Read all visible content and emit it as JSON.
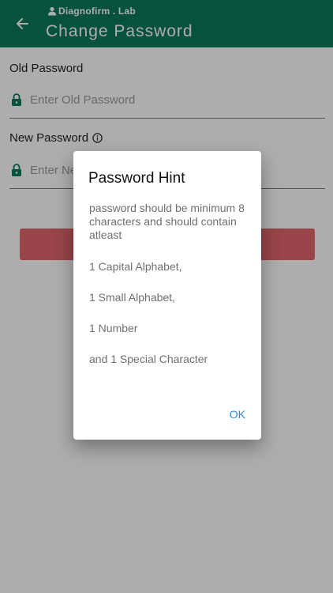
{
  "header": {
    "org_name": "Diagnofirm . Lab",
    "title": "Change Password"
  },
  "form": {
    "old_password": {
      "label": "Old Password",
      "placeholder": "Enter Old Password"
    },
    "new_password": {
      "label": "New Password",
      "placeholder": "Enter New Password"
    },
    "submit_label": ""
  },
  "dialog": {
    "title": "Password Hint",
    "intro": "password should be minimum 8 characters and should contain atleast",
    "rules": [
      "1 Capital Alphabet,",
      "1 Small Alphabet,",
      "1 Number",
      "and 1 Special Character"
    ],
    "ok_label": "OK"
  },
  "colors": {
    "primary": "#0a7a5a",
    "accent_button": "#e0656b",
    "dialog_action": "#2b88e0",
    "lock_icon": "#0a7a5a"
  }
}
